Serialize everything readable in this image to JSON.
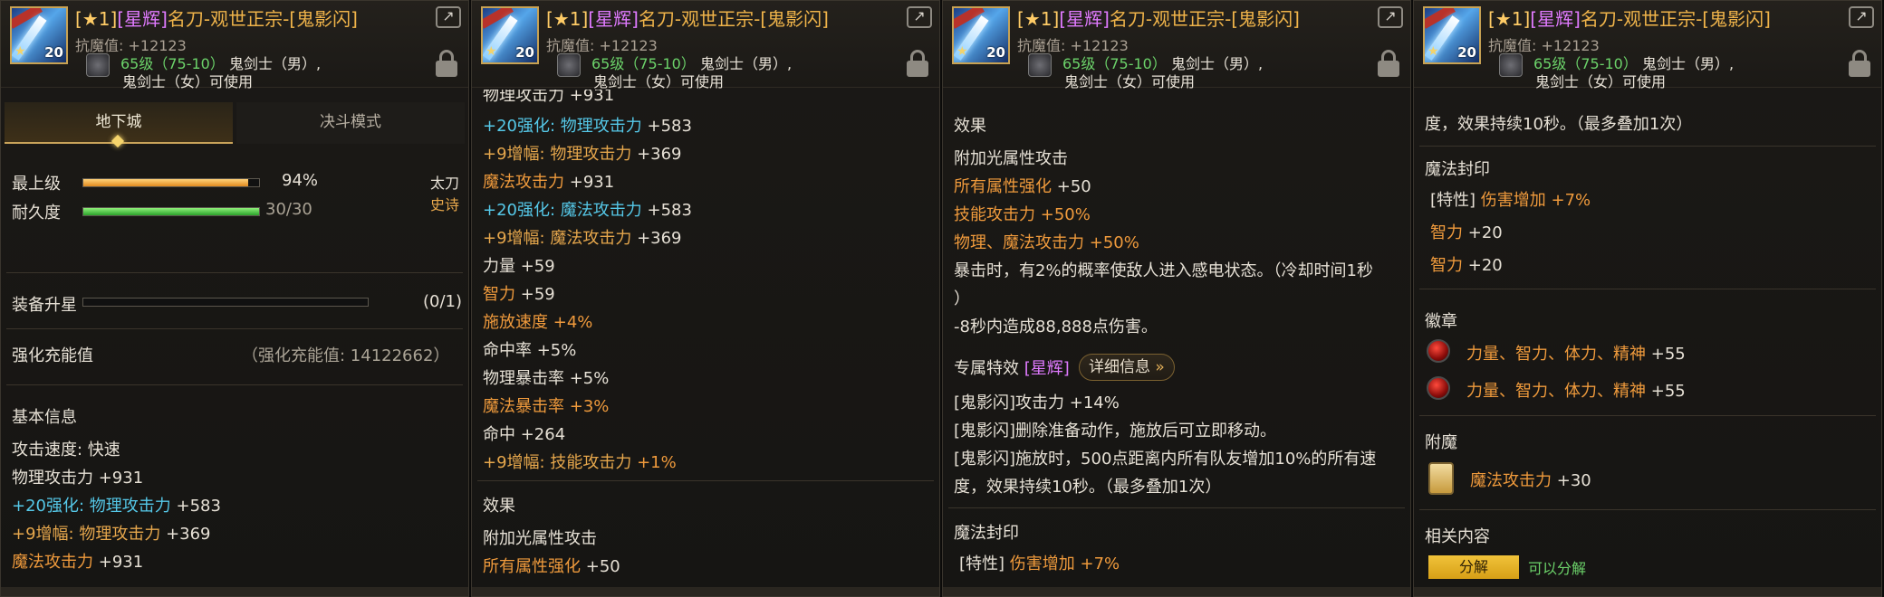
{
  "header": {
    "title_prefix": "[★1]",
    "title_tag": "[星辉]",
    "title_name": "名刀-观世正宗-[鬼影闪]",
    "resist": "抗魔值: +12123",
    "level_req": "65级（75-10）",
    "class_line1": "鬼剑士（男）,",
    "class_line2": "鬼剑士（女）可使用",
    "icon_level": "20"
  },
  "panel1": {
    "tabs": [
      "地下城",
      "决斗模式"
    ],
    "grade_label": "最上级",
    "grade_value": "94%",
    "grade_fill": 0.94,
    "durability_label": "耐久度",
    "durability_value": "30/30",
    "durability_fill": 1.0,
    "weapon_type": "太刀",
    "rarity": "史诗",
    "upgrade_label": "装备升星",
    "upgrade_value": "(0/1)",
    "upgrade_fill": 0.0,
    "charge_label": "强化充能值",
    "charge_value": "（强化充能值: 14122662）",
    "basic_info": "基本信息",
    "attack_speed": "攻击速度: 快速",
    "phys_atk": "物理攻击力 +931",
    "enh_prefix": "+20强化:",
    "enh_phys": " 物理攻击力 ",
    "enh_phys_val": "+583",
    "amp_prefix": "+9增幅:",
    "amp_phys": " 物理攻击力 ",
    "amp_phys_val": "+369",
    "mag_atk_label": "魔法攻击力",
    "mag_atk_val": "+931"
  },
  "panel2": {
    "partial_top": "物理攻击力 +931",
    "enh_prefix": "+20强化:",
    "enh_phys": " 物理攻击力 ",
    "enh_phys_val": "+583",
    "amp_prefix": "+9增幅:",
    "amp_phys": " 物理攻击力 ",
    "amp_phys_val": "+369",
    "mag_atk_label": "魔法攻击力",
    "mag_atk_val": "+931",
    "enh_mag": " 魔法攻击力 ",
    "enh_mag_val": "+583",
    "amp_mag": " 魔法攻击力 ",
    "amp_mag_val": "+369",
    "str": "力量 +59",
    "int_label": "智力",
    "int_val": "+59",
    "cast_label": "施放速度",
    "cast_val": "+4%",
    "hit_rate": "命中率 +5%",
    "phys_crit": "物理暴击率 +5%",
    "mag_crit_label": "魔法暴击率",
    "mag_crit_val": "+3%",
    "hit": "命中 +264",
    "amp_skill": " 技能攻击力 ",
    "amp_skill_val": "+1%",
    "effect_head": "效果",
    "light_attack": "附加光属性攻击",
    "all_elem_label": "所有属性强化",
    "all_elem_val": "+50"
  },
  "panel3": {
    "effect_head": "效果",
    "light_attack": "附加光属性攻击",
    "all_elem_label": "所有属性强化",
    "all_elem_val": "+50",
    "skill_atk_label": "技能攻击力",
    "skill_atk_val": "+50%",
    "pm_atk_label": "物理、魔法攻击力",
    "pm_atk_val": "+50%",
    "crit_line1": "暴击时，有2%的概率使敌人进入感电状态。（冷却时间1秒",
    "crit_line2": "）",
    "dmg_line": "-8秒内造成88,888点伤害。",
    "special_head": "专属特效",
    "special_tag": "[星辉]",
    "detail_btn": "详细信息",
    "sp1": "[鬼影闪]攻击力 +14%",
    "sp2": "[鬼影闪]删除准备动作，施放后可立即移动。",
    "sp3": "[鬼影闪]施放时，500点距离内所有队友增加10%的所有速",
    "sp4": "度，效果持续10秒。（最多叠加1次）",
    "seal_head": "魔法封印",
    "seal_trait": "[特性]",
    "seal_label": " 伤害增加 ",
    "seal_val": "+7%"
  },
  "panel4": {
    "partial_top": "度，效果持续10秒。（最多叠加1次）",
    "seal_head": "魔法封印",
    "seal_trait": "[特性]",
    "seal_label": " 伤害增加 ",
    "seal_val": "+7%",
    "int1_label": "智力",
    "int1_val": "+20",
    "int2_label": "智力",
    "int2_val": "+20",
    "emblem_head": "徽章",
    "emblem1_label": "力量、智力、体力、精神",
    "emblem1_val": "+55",
    "emblem2_label": "力量、智力、体力、精神",
    "emblem2_val": "+55",
    "enchant_head": "附魔",
    "enchant_label": "魔法攻击力",
    "enchant_val": "+30",
    "related_head": "相关内容",
    "decompose_btn": "分解",
    "can_decompose": "可以分解"
  },
  "colors": {
    "orange": "#ef9a3c",
    "cyan": "#55c8e8",
    "gold": "#e6a74c",
    "green": "#6cd36a",
    "title": "#f0b44a"
  }
}
